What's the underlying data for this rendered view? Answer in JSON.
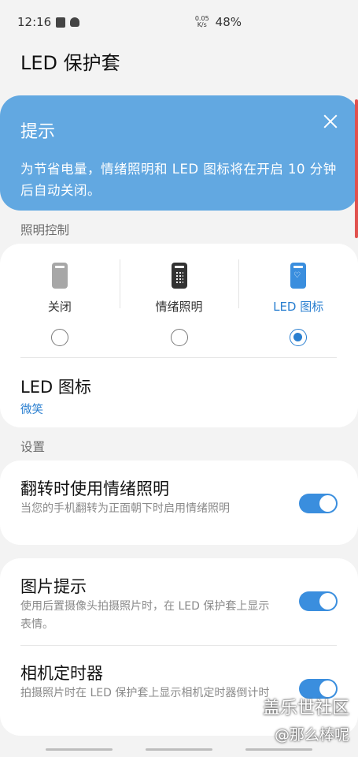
{
  "status_bar": {
    "time": "12:16",
    "net_speed_value": "0.05",
    "net_speed_unit": "K/s",
    "battery": "48%"
  },
  "page_title": "LED 保护套",
  "tip": {
    "title": "提示",
    "text": "为节省电量，情绪照明和 LED 图标将在开启 10 分钟后自动关闭。"
  },
  "lighting_section": {
    "label": "照明控制",
    "modes": [
      {
        "label": "关闭",
        "selected": false
      },
      {
        "label": "情绪照明",
        "selected": false
      },
      {
        "label": "LED 图标",
        "selected": true
      }
    ],
    "led_icon_title": "LED 图标",
    "led_icon_value": "微笑"
  },
  "settings_section": {
    "label": "设置",
    "flip": {
      "title": "翻转时使用情绪照明",
      "desc": "当您的手机翻转为正面朝下时启用情绪照明",
      "on": true
    },
    "photo_hint": {
      "title": "图片提示",
      "desc": "使用后置摄像头拍摄照片时，在 LED 保护套上显示表情。",
      "on": true
    },
    "timer": {
      "title": "相机定时器",
      "desc": "拍摄照片时在 LED 保护套上显示相机定时器倒计时",
      "on": true
    }
  },
  "watermark": {
    "line1": "盖乐世社区",
    "line2": "@那么棒呢"
  },
  "colors": {
    "accent": "#3a8ede",
    "tip_bg": "#62a8e1",
    "background": "#f3f3f3"
  }
}
